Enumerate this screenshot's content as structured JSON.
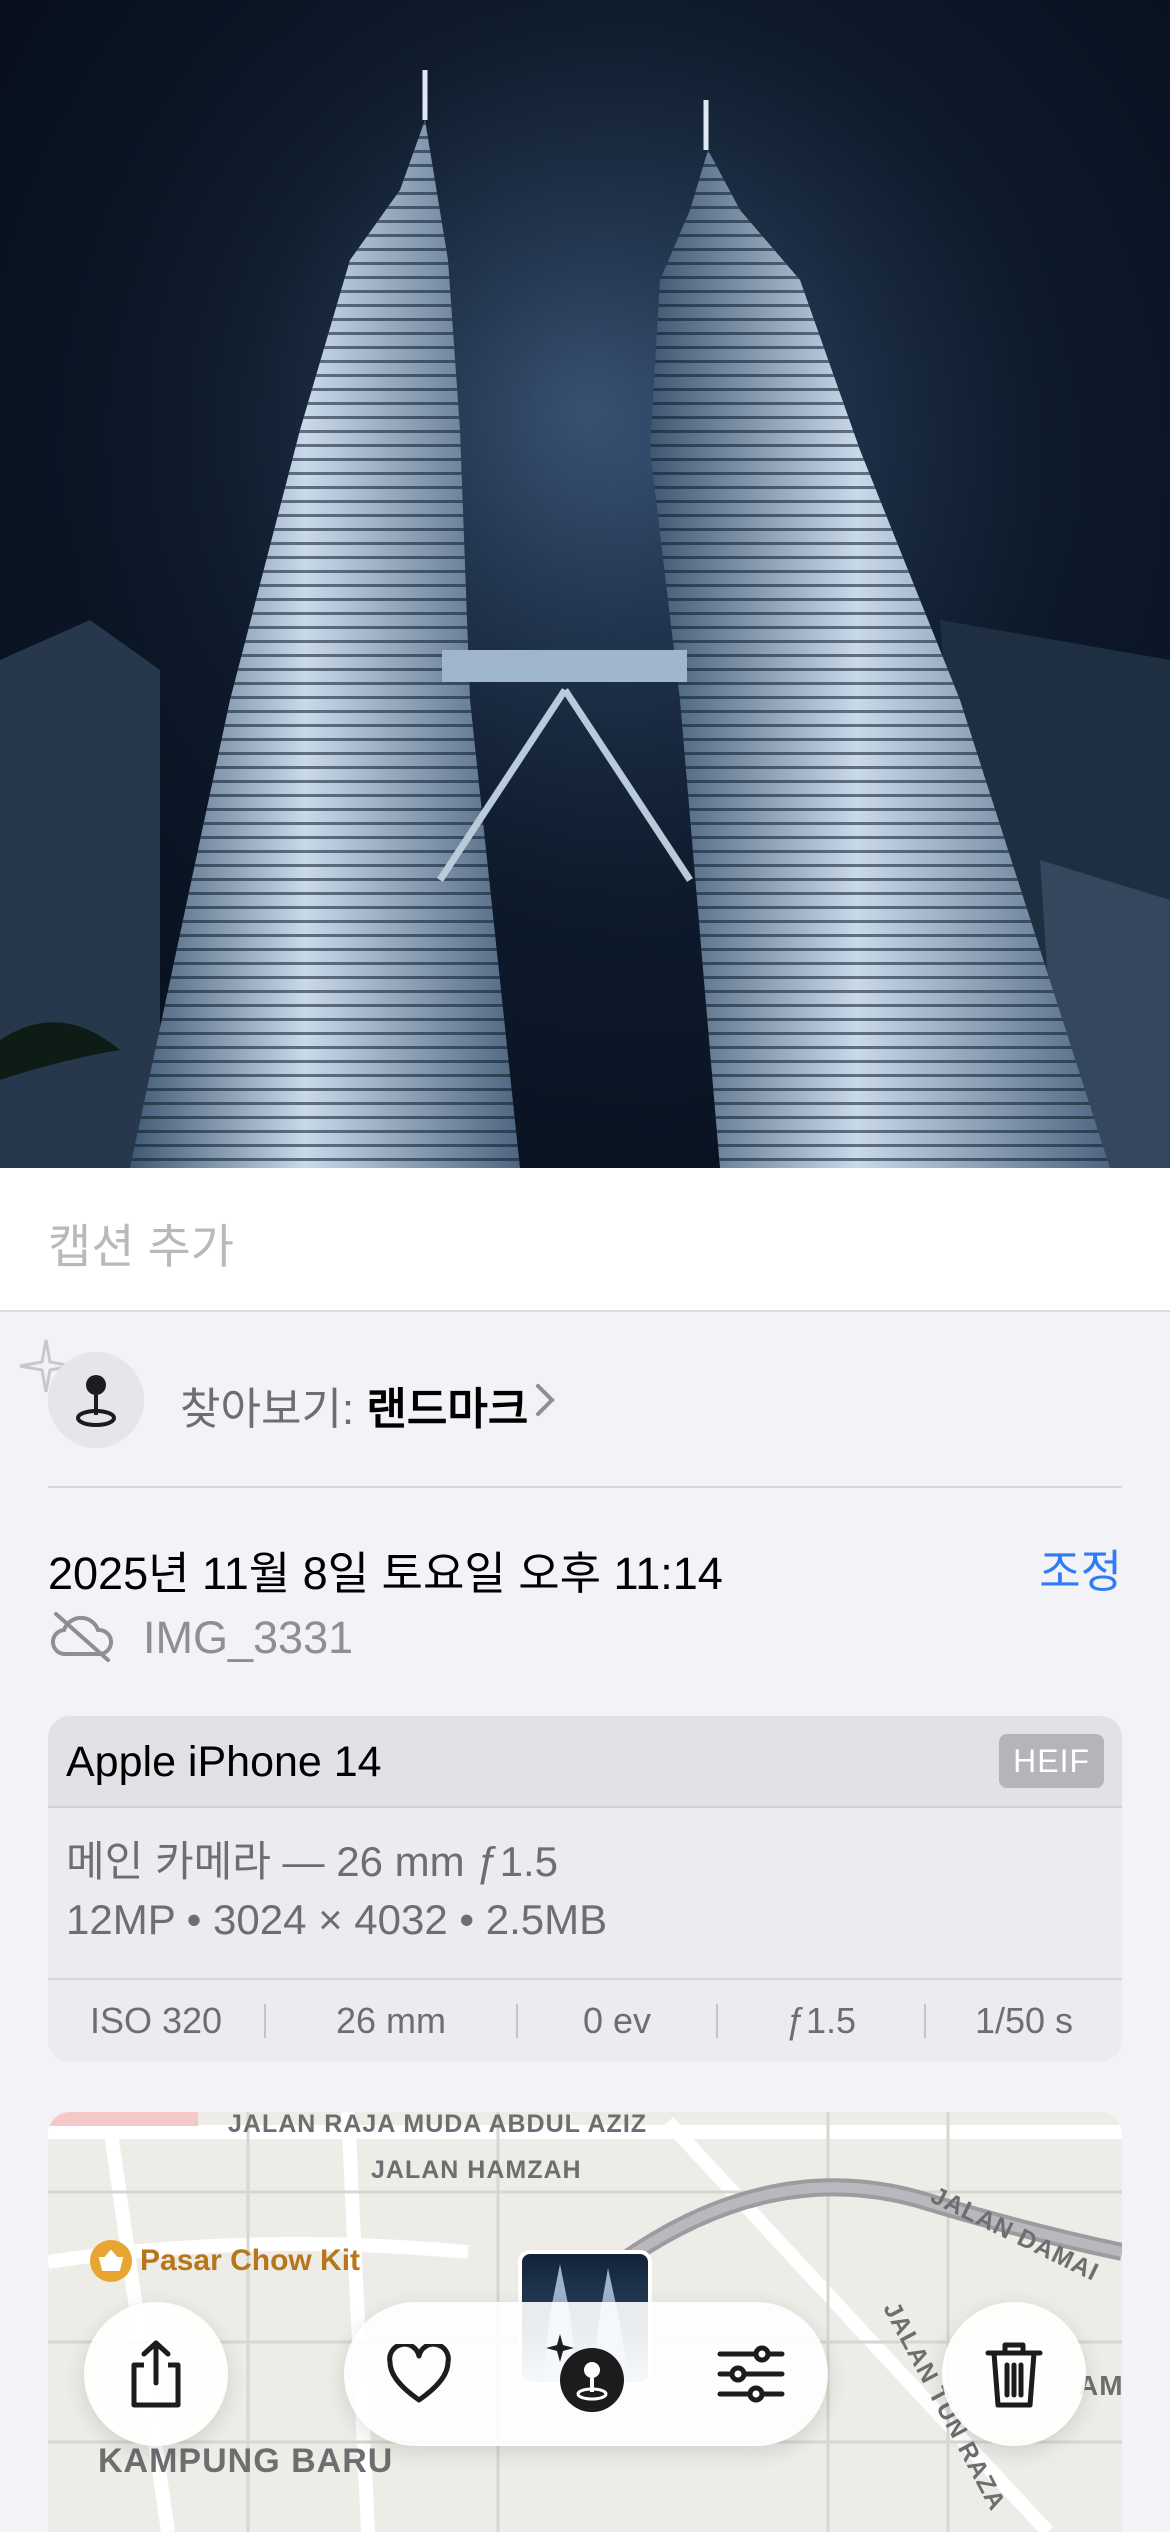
{
  "caption": {
    "placeholder": "캡션 추가"
  },
  "lookup": {
    "prefix": "찾아보기:",
    "value": "랜드마크"
  },
  "info": {
    "date": "2025년 11월 8일 토요일 오후 11:14",
    "adjust_label": "조정",
    "filename": "IMG_3331"
  },
  "exif": {
    "device": "Apple iPhone 14",
    "format": "HEIF",
    "lens": "메인 카메라 — 26 mm ƒ1.5",
    "specs": "12MP • 3024 × 4032 • 2.5MB",
    "iso": "ISO 320",
    "focal": "26 mm",
    "ev": "0 ev",
    "aperture": "ƒ1.5",
    "shutter": "1/50 s"
  },
  "map": {
    "labels": {
      "raja_muda": "JALAN RAJA MUDA ABDUL AZIZ",
      "hamzah": "JALAN HAMZAH",
      "damai": "JALAN DAMAI",
      "tun_razak": "JALAN TUN RAZA",
      "kampung": "KAMPUNG BARU",
      "am": "AM"
    },
    "poi": "Pasar Chow Kit"
  },
  "colors": {
    "accent": "#2e7cf6",
    "poi": "#e8a531"
  },
  "icons": [
    "sparkle-icon",
    "landmark-pin-icon",
    "chevron-right-icon",
    "cloud-off-icon",
    "share-icon",
    "heart-icon",
    "visual-lookup-icon",
    "adjust-sliders-icon",
    "trash-icon",
    "basket-icon"
  ]
}
